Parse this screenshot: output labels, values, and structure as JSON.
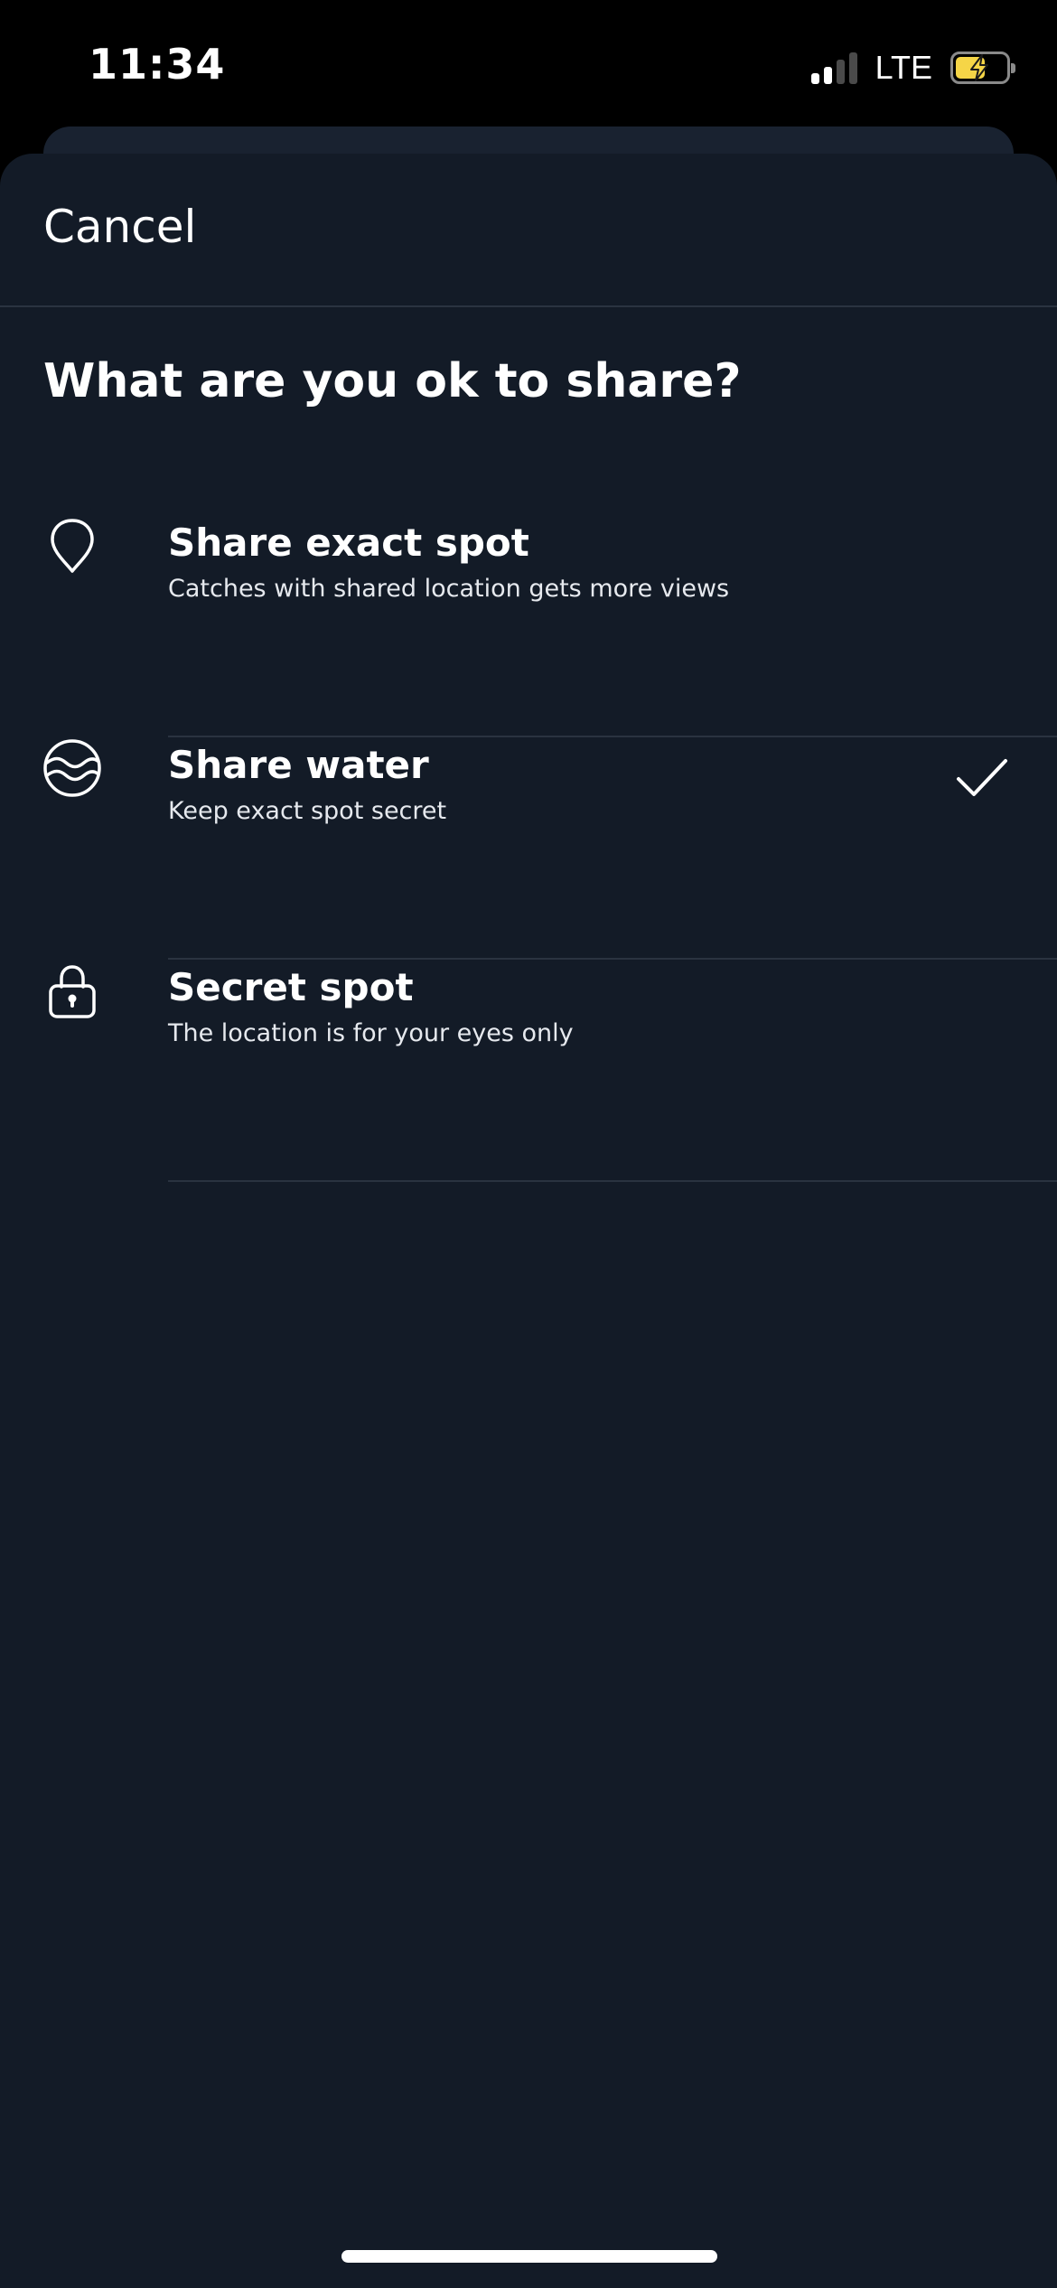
{
  "status_bar": {
    "time": "11:34",
    "network": "LTE",
    "signal_bars": 2,
    "signal_bars_total": 4,
    "battery_level": 0.6,
    "battery_charging": true
  },
  "header": {
    "cancel_label": "Cancel"
  },
  "main": {
    "title": "What are you ok to share?",
    "options": [
      {
        "title": "Share exact spot",
        "subtitle": "Catches with shared location gets more views",
        "icon": "location-pin-icon",
        "selected": false
      },
      {
        "title": "Share water",
        "subtitle": "Keep exact spot secret",
        "icon": "water-waves-icon",
        "selected": true
      },
      {
        "title": "Secret spot",
        "subtitle": "The location is for your eyes only",
        "icon": "lock-icon",
        "selected": false
      }
    ]
  },
  "colors": {
    "sheet_background": "#131b27",
    "divider": "#2a3340",
    "text_primary": "#ffffff",
    "battery_fill": "#f5d547"
  }
}
